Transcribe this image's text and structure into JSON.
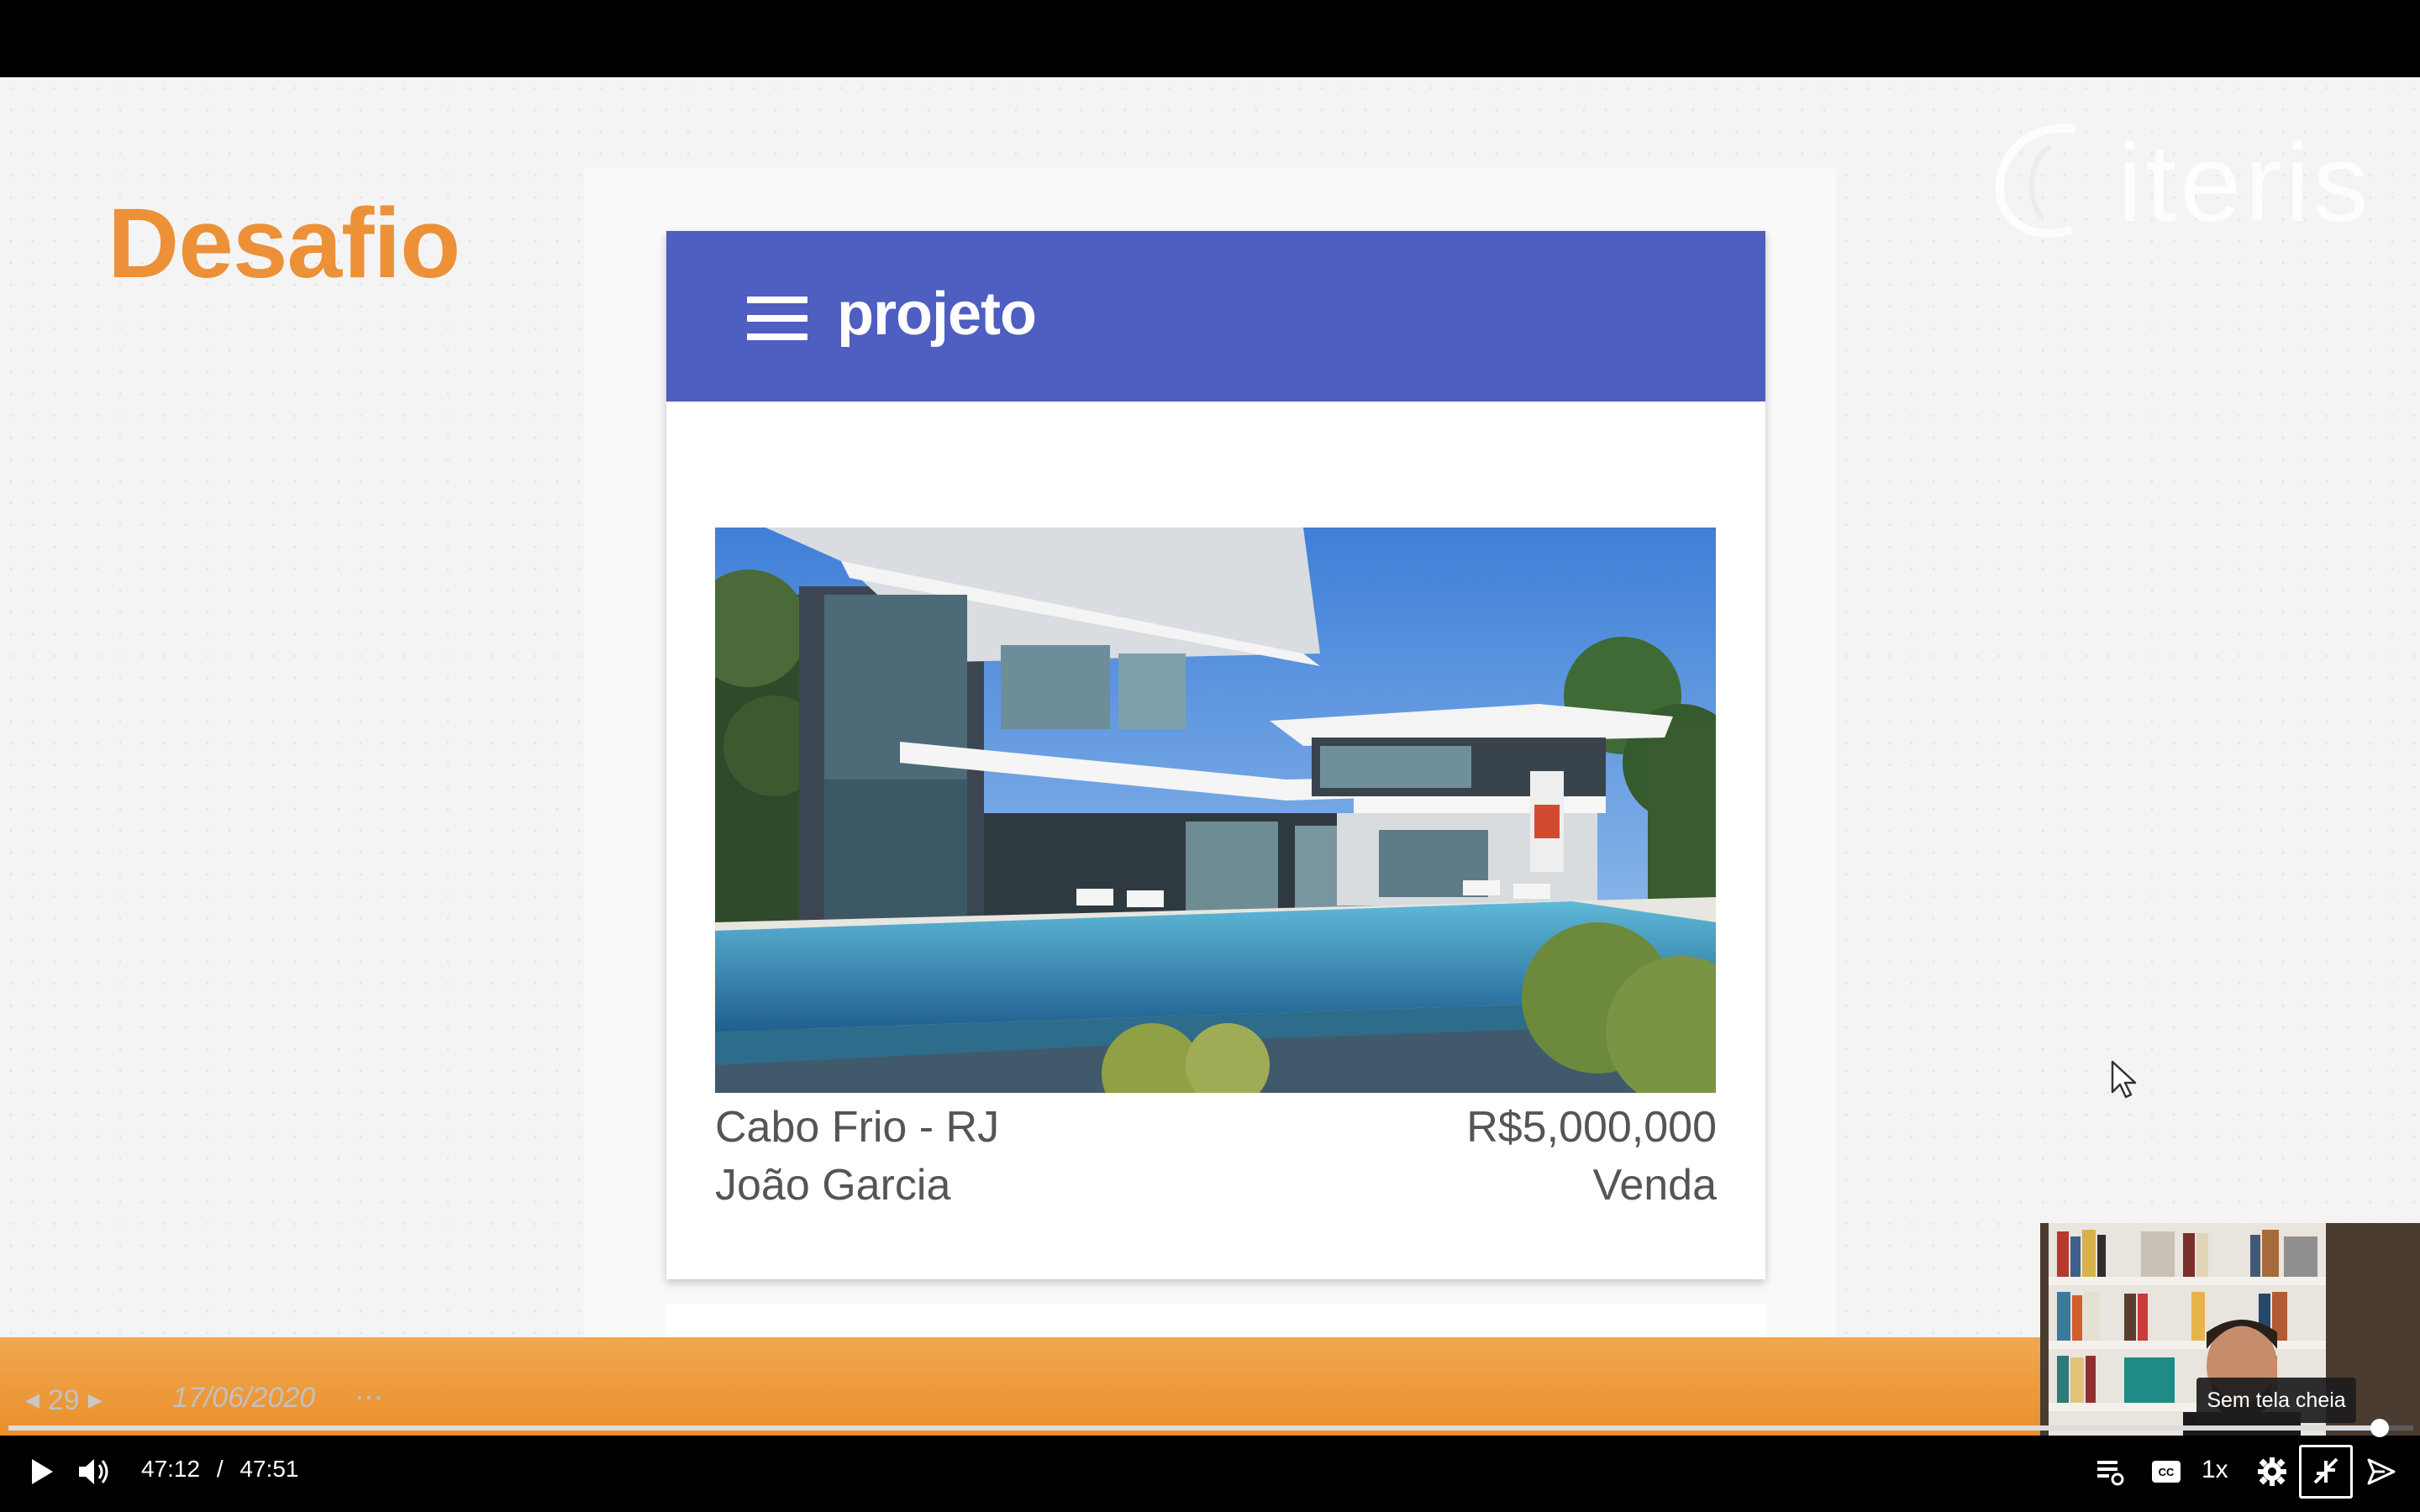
{
  "slide": {
    "title": "Desafio",
    "logo_text": "iteris",
    "logo_tagline": "",
    "page_number": "29",
    "date": "17/06/2020",
    "more": "⋯"
  },
  "app": {
    "toolbar_title": "projeto",
    "toolbar_color": "#4e5ec1",
    "menu_icon": "hamburger-menu-icon",
    "listing": {
      "location": "Cabo Frio - RJ",
      "owner": "João Garcia",
      "price": "R$5,000,000",
      "type": "Venda"
    }
  },
  "player": {
    "current_time": "47:12",
    "separator": "/",
    "duration": "47:51",
    "progress_fraction": 0.986,
    "speed": "1x",
    "tooltip": "Sem tela cheia",
    "accent": "#ea8f2c",
    "icons": [
      "play-icon",
      "volume-icon",
      "transcript-icon",
      "captions-icon",
      "settings-icon",
      "exit-fullscreen-icon",
      "share-icon"
    ]
  }
}
